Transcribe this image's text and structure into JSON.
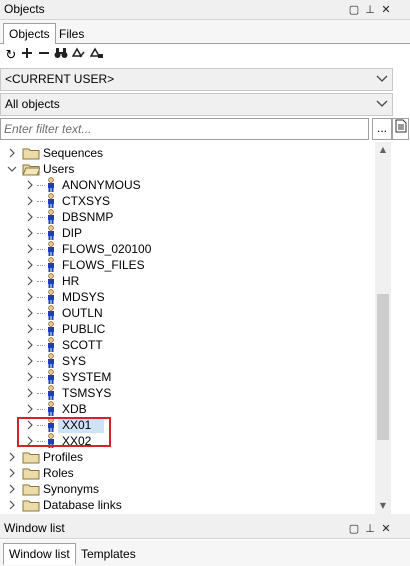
{
  "objects_panel": {
    "title": "Objects",
    "tabs": [
      {
        "label": "Objects",
        "active": true
      },
      {
        "label": "Files",
        "active": false
      }
    ],
    "toolbar_icons": [
      "refresh-icon",
      "add-icon",
      "remove-icon",
      "binoculars-icon",
      "filter-icon",
      "filter-settings-icon"
    ],
    "schema_combo": "<CURRENT USER>",
    "type_combo": "All objects",
    "filter_placeholder": "Enter filter text...",
    "filter_buttons": {
      "ellipsis": "..."
    },
    "tree": {
      "top_folders": [
        {
          "label": "Sequences",
          "expanded": false
        },
        {
          "label": "Users",
          "expanded": true
        }
      ],
      "users": [
        "ANONYMOUS",
        "CTXSYS",
        "DBSNMP",
        "DIP",
        "FLOWS_020100",
        "FLOWS_FILES",
        "HR",
        "MDSYS",
        "OUTLN",
        "PUBLIC",
        "SCOTT",
        "SYS",
        "SYSTEM",
        "TSMSYS",
        "XDB",
        "XX01",
        "XX02"
      ],
      "selected_user": "XX01",
      "bottom_folders": [
        {
          "label": "Profiles"
        },
        {
          "label": "Roles"
        },
        {
          "label": "Synonyms"
        },
        {
          "label": "Database links"
        }
      ]
    },
    "highlight_color": "#d0232a"
  },
  "window_list_panel": {
    "title": "Window list",
    "tabs": [
      {
        "label": "Window list",
        "active": true
      },
      {
        "label": "Templates",
        "active": false
      }
    ]
  }
}
